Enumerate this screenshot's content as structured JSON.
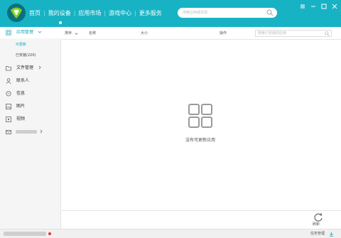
{
  "nav": {
    "items": [
      "首页",
      "我的设备",
      "应用市场",
      "游戏中心",
      "更多服务"
    ],
    "search_placeholder": "搜索应用或资源"
  },
  "sidebar": {
    "apps_label": "应用管理",
    "sub_updatable": "可更新",
    "sub_installed": "已安装(220)",
    "files_label": "文件管理",
    "contacts_label": "联系人",
    "messages_label": "信息",
    "pictures_label": "图片",
    "videos_label": "视频"
  },
  "table": {
    "sort_label": "排序",
    "name_label": "名称",
    "size_label": "大小",
    "action_label": "操作",
    "search_placeholder": "搜索已安装的应用"
  },
  "main": {
    "empty_text": "没有可更新应用",
    "refresh_label": "刷新"
  },
  "status": {
    "task_label": "任务管理"
  },
  "colors": {
    "accent": "#17b3c4",
    "accent_text": "#17a7b9"
  }
}
